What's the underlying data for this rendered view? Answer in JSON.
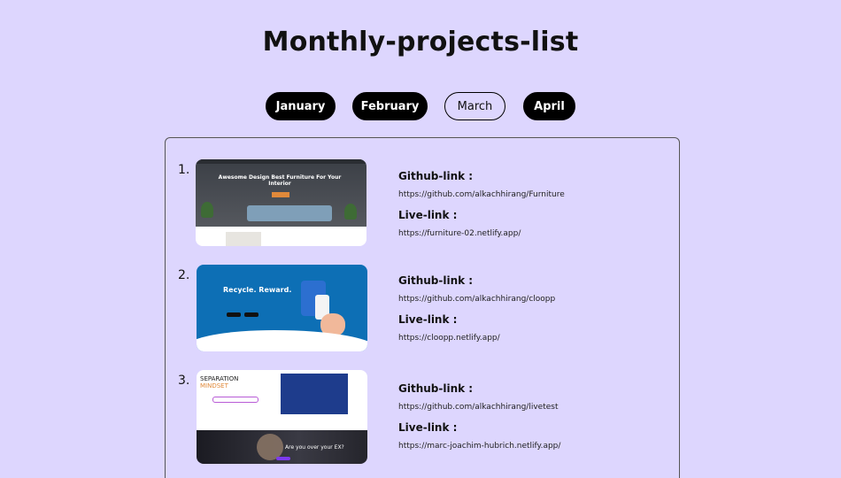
{
  "page": {
    "title": "Monthly-projects-list"
  },
  "months": [
    {
      "label": "January",
      "style": "filled"
    },
    {
      "label": "February",
      "style": "filled"
    },
    {
      "label": "March",
      "style": "outline"
    },
    {
      "label": "April",
      "style": "filled"
    }
  ],
  "projects": [
    {
      "number": "1.",
      "github_label": "Github-link :",
      "github_url": "https://github.com/alkachhirang/Furniture",
      "live_label": "Live-link :",
      "live_url": "https://furniture-02.netlify.app/",
      "thumb_heading": "Awesome Design Best Furniture For Your Interior"
    },
    {
      "number": "2.",
      "github_label": "Github-link :",
      "github_url": "https://github.com/alkachhirang/cloopp",
      "live_label": "Live-link :",
      "live_url": "https://cloopp.netlify.app/",
      "thumb_heading": "Recycle. Reward."
    },
    {
      "number": "3.",
      "github_label": "Github-link :",
      "github_url": "https://github.com/alkachhirang/livetest",
      "live_label": "Live-link :",
      "live_url": "https://marc-joachim-hubrich.netlify.app/",
      "thumb_heading": "SEPARATION",
      "thumb_heading_accent": "MINDSET",
      "thumb_caption": "Are you over your EX?"
    }
  ],
  "colors": {
    "background": "#ddd6fe",
    "button_filled": "#000000",
    "panel_border": "#555555"
  }
}
